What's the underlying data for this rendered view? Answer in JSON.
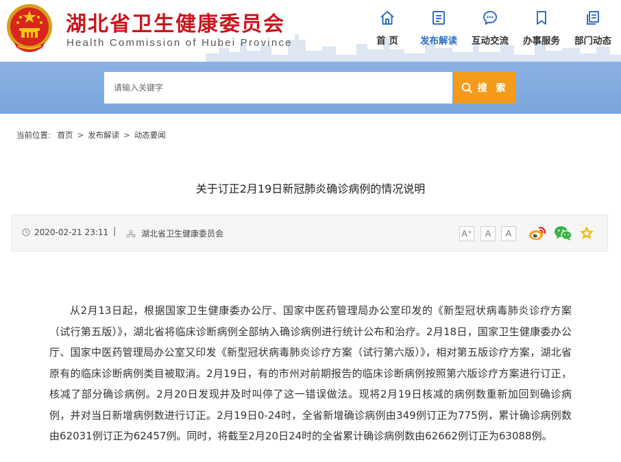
{
  "header": {
    "title": "湖北省卫生健康委员会",
    "subtitle": "Health Commission of Hubei Province",
    "nav": [
      {
        "label": "首 页",
        "icon": "home-icon"
      },
      {
        "label": "发布解读",
        "icon": "document-icon"
      },
      {
        "label": "互动交流",
        "icon": "chat-bubble-icon"
      },
      {
        "label": "办事服务",
        "icon": "bookmark-icon"
      },
      {
        "label": "部门动态",
        "icon": "copy-pages-icon"
      }
    ],
    "active_nav": "发布解读"
  },
  "search": {
    "placeholder": "请输入关键字",
    "button_label": "搜 索"
  },
  "breadcrumb": {
    "prefix": "当前位置:",
    "items": [
      "首页",
      "发布解读",
      "动态要闻"
    ],
    "separator": ">"
  },
  "article": {
    "title": "关于订正2月19日新冠肺炎确诊病例的情况说明",
    "date": "2020-02-21 23:11",
    "meta_separator": "|",
    "source": "湖北省卫生健康委员会",
    "font_controls": [
      "A⁺",
      "A",
      "A"
    ],
    "share_icons": [
      "weibo-icon",
      "wechat-icon",
      "favorite-star-icon"
    ],
    "body": "从2月13日起，根据国家卫生健康委办公厅、国家中医药管理局办公室印发的《新型冠状病毒肺炎诊疗方案（试行第五版）》，湖北省将临床诊断病例全部纳入确诊病例进行统计公布和治疗。2月18日，国家卫生健康委办公厅、国家中医药管理局办公室又印发《新型冠状病毒肺炎诊疗方案（试行第六版）》，相对第五版诊疗方案，湖北省原有的临床诊断病例类目被取消。2月19日，有的市州对前期报告的临床诊断病例按照第六版诊疗方案进行订正，核减了部分确诊病例。2月20日发现并及时叫停了这一错误做法。现将2月19日核减的病例数重新加回到确诊病例，并对当日新增病例数进行订正。2月19日0-24时，全省新增确诊病例由349例订正为775例，累计确诊病例数由62031例订正为62457例。同时，将截至2月20日24时的全省累计确诊病例数由62662例订正为63088例。"
  },
  "colors": {
    "brand_red": "#c8161d",
    "nav_active": "#2f6ec2",
    "search_band": "#7aa5dc",
    "search_button": "#f59b1c"
  }
}
